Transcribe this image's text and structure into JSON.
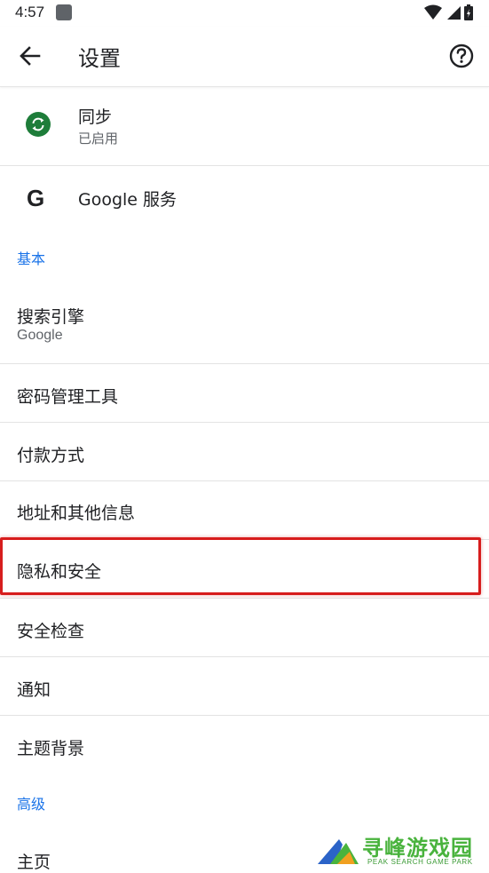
{
  "status_bar": {
    "time": "4:57"
  },
  "toolbar": {
    "title": "设置"
  },
  "account": {
    "sync_label": "同步",
    "sync_status": "已启用",
    "google_services_label": "Google 服务"
  },
  "sections": {
    "basic_header": "基本",
    "advanced_header": "高级"
  },
  "basic_items": {
    "search_engine_label": "搜索引擎",
    "search_engine_value": "Google",
    "password_manager": "密码管理工具",
    "payment_methods": "付款方式",
    "addresses": "地址和其他信息",
    "privacy_security": "隐私和安全",
    "safety_check": "安全检查",
    "notifications": "通知",
    "theme": "主题背景"
  },
  "advanced_items": {
    "homepage": "主页"
  },
  "highlight": {
    "target": "privacy_security",
    "color": "#d71d1d"
  },
  "watermark": {
    "title": "寻峰游戏园",
    "subtitle": "PEAK SEARCH GAME PARK"
  },
  "colors": {
    "accent": "#1a73e8",
    "sync_green": "#1e7d3a"
  }
}
